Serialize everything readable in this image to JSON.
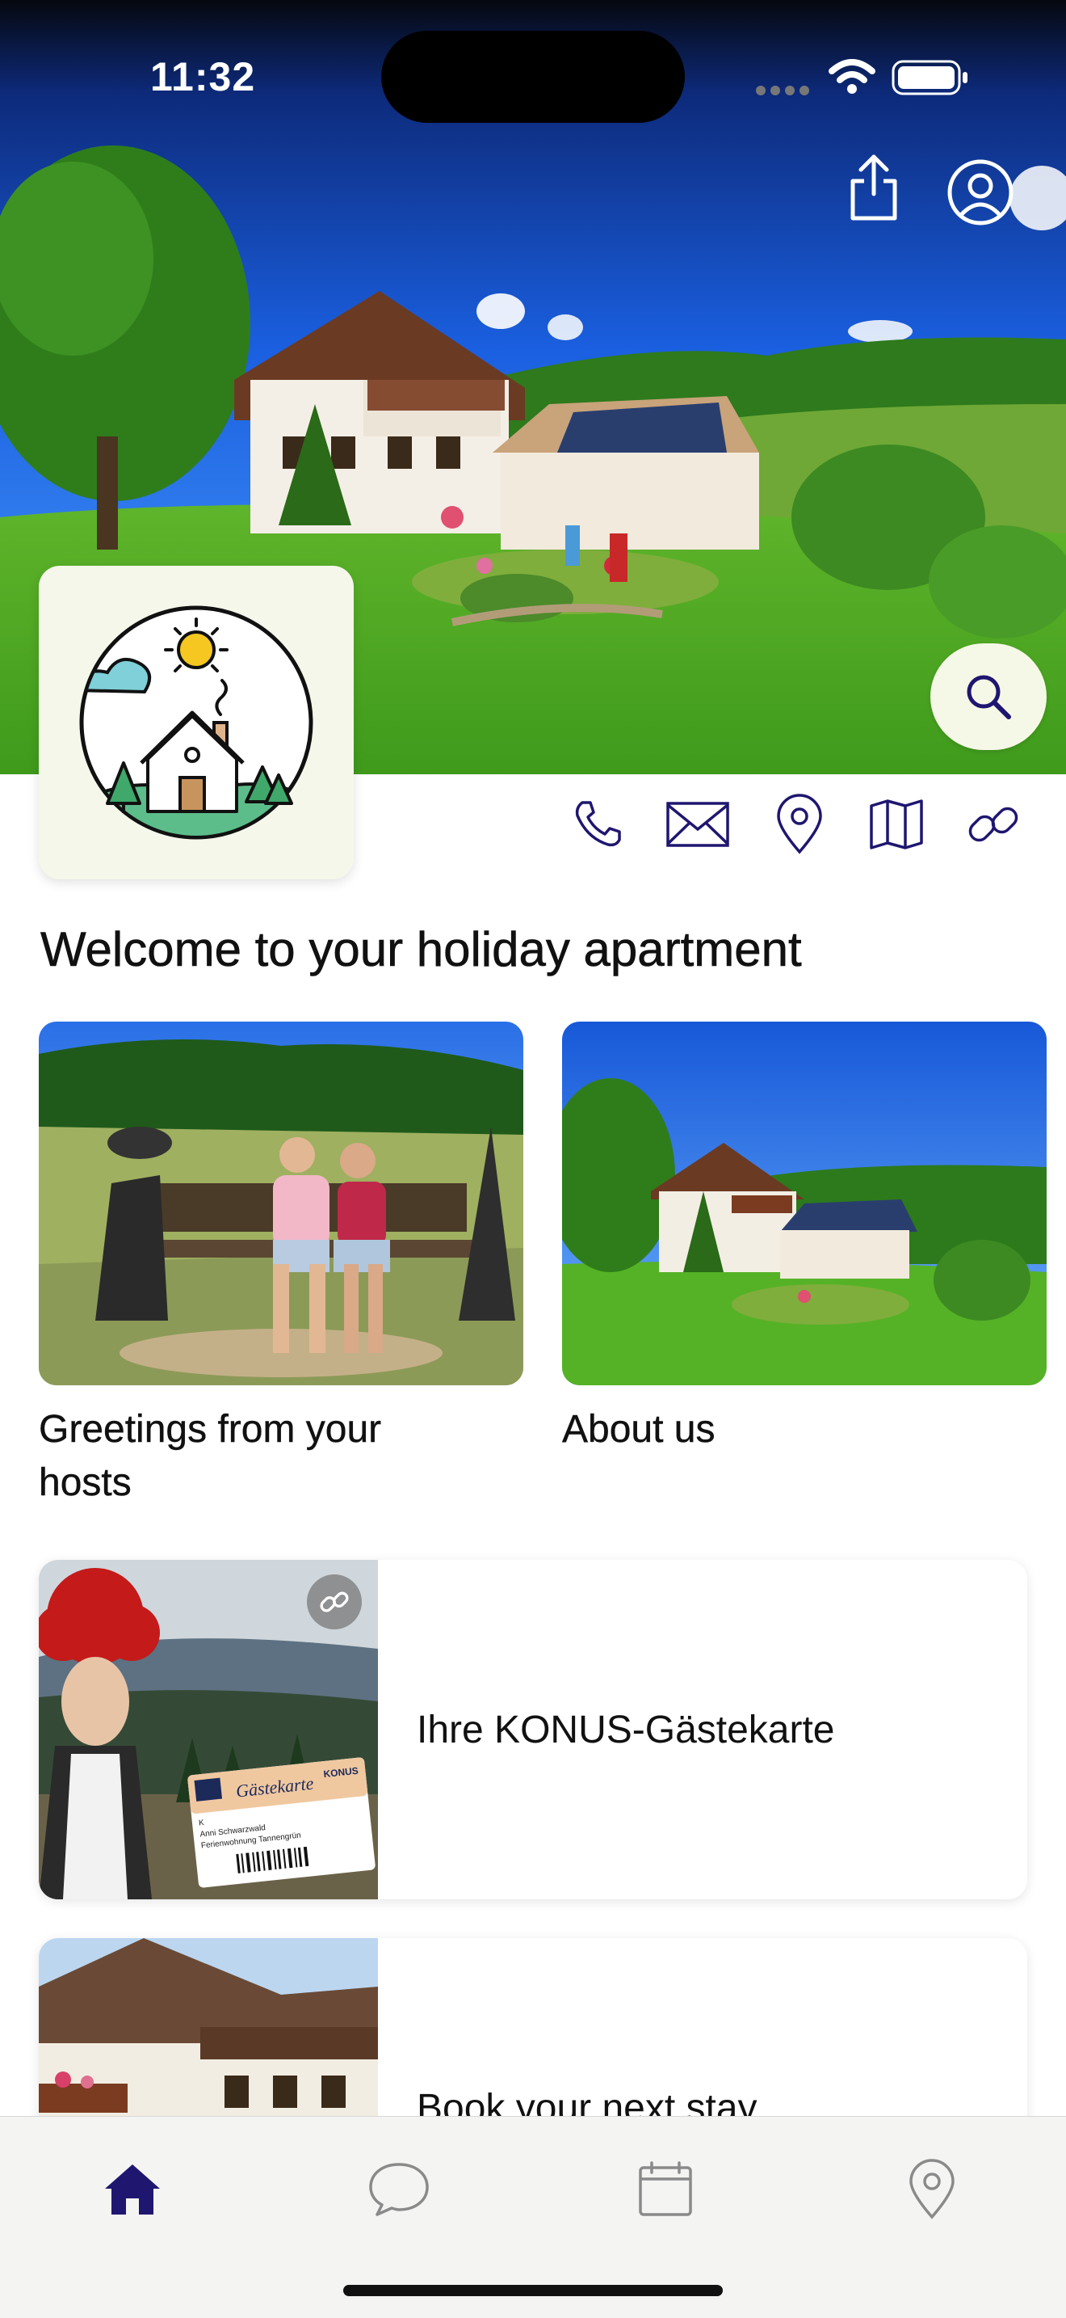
{
  "status_bar": {
    "time": "11:32"
  },
  "welcome": {
    "title": "Welcome to your holiday apartment"
  },
  "tiles": [
    {
      "label": "Greetings from your hosts"
    },
    {
      "label": "About us"
    }
  ],
  "list_cards": [
    {
      "label": "Ihre KONUS-Gästekarte",
      "has_link_badge": true,
      "card_text": [
        "Gästekarte",
        "KONUS",
        "K",
        "Anni Schwarzwald",
        "Ferienwohnung Tannengrün"
      ]
    },
    {
      "label": "Book your next stay"
    }
  ],
  "icons": {
    "share": "share-icon",
    "profile": "profile-icon",
    "search": "search-icon",
    "phone": "phone-icon",
    "email": "envelope-icon",
    "location": "location-pin-icon",
    "map": "map-icon",
    "link": "link-icon"
  },
  "tab_bar": {
    "tabs": [
      {
        "name": "home",
        "icon": "home-icon",
        "active": true
      },
      {
        "name": "chat",
        "icon": "chat-bubble-icon",
        "active": false
      },
      {
        "name": "calendar",
        "icon": "calendar-icon",
        "active": false
      },
      {
        "name": "location",
        "icon": "location-pin-icon",
        "active": false
      }
    ]
  },
  "colors": {
    "accent": "#1f1670",
    "inactive_icon": "#8a8a8a",
    "logo_bg": "#f4f7ea",
    "search_bg": "#f5f8e6"
  }
}
